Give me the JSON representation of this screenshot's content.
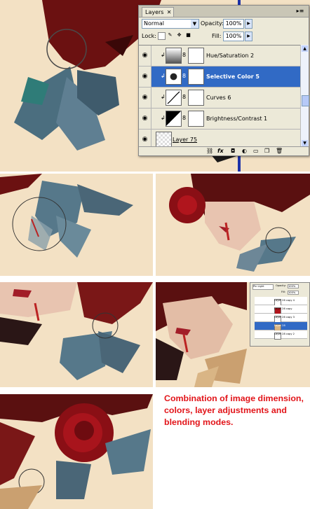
{
  "layers_panel": {
    "tab_title": "Layers",
    "blend_mode": "Normal",
    "opacity_label": "Opacity:",
    "opacity_value": "100%",
    "lock_label": "Lock:",
    "fill_label": "Fill:",
    "fill_value": "100%",
    "layers": [
      {
        "name": "Hue/Saturation 2",
        "selected": false
      },
      {
        "name": "Selective Color 5",
        "selected": true
      },
      {
        "name": "Curves 6",
        "selected": false
      },
      {
        "name": "Brightness/Contrast 1",
        "selected": false
      },
      {
        "name": "Layer 75",
        "selected": false
      }
    ],
    "bottom_icons": [
      "link-icon",
      "fx-icon",
      "mask-icon",
      "adjustment-icon",
      "folder-icon",
      "new-layer-icon",
      "trash-icon"
    ],
    "bottom_fx": "fx"
  },
  "mini_panel": {
    "blend_mode": "Pin Light",
    "opacity_label": "Opacity:",
    "opacity_value": "100%",
    "fill_label": "Fill:",
    "fill_value": "100%",
    "layers": [
      {
        "name": "Layer 26 copy 4",
        "selected": false
      },
      {
        "name": "Layer 26 copy",
        "selected": false
      },
      {
        "name": "Layer 26 copy 3",
        "selected": false
      },
      {
        "name": "Layer 28",
        "selected": true
      },
      {
        "name": "Layer 28 copy 2",
        "selected": false
      }
    ]
  },
  "caption": "Combination of image dimension, colors, layer adjustments and blending modes.",
  "colors": {
    "background": "#f3e1c4",
    "caption": "#e2151a",
    "selection": "#316ac5",
    "hair": "#7a1414",
    "leaves": "#4f6a7e"
  }
}
